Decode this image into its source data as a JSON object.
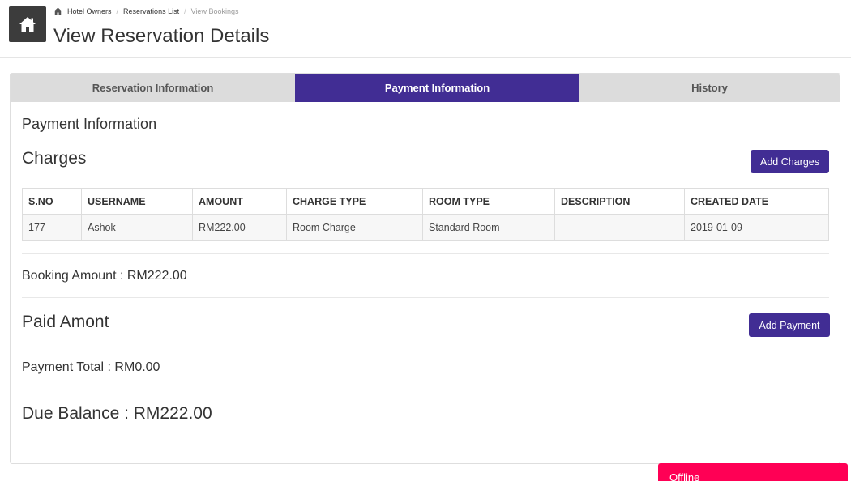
{
  "breadcrumb": {
    "items": [
      "Hotel Owners",
      "Reservations List"
    ],
    "current": "View Bookings"
  },
  "page": {
    "title": "View Reservation Details"
  },
  "tabs": [
    {
      "label": "Reservation Information",
      "active": false
    },
    {
      "label": "Payment Information",
      "active": true
    },
    {
      "label": "History",
      "active": false
    }
  ],
  "payment": {
    "section_title": "Payment Information",
    "charges_title": "Charges",
    "add_charges_label": "Add Charges",
    "table": {
      "headers": [
        "S.NO",
        "USERNAME",
        "AMOUNT",
        "CHARGE TYPE",
        "ROOM TYPE",
        "DESCRIPTION",
        "CREATED DATE"
      ],
      "rows": [
        [
          "177",
          "Ashok",
          "RM222.00",
          "Room Charge",
          "Standard Room",
          "-",
          "2019-01-09"
        ]
      ]
    },
    "booking_amount": "Booking Amount : RM222.00",
    "paid_title": "Paid Amont",
    "add_payment_label": "Add Payment",
    "payment_total": "Payment Total : RM0.00",
    "due_balance": "Due Balance : RM222.00"
  },
  "chat": {
    "status": "Offline"
  },
  "colors": {
    "accent": "#412d94",
    "chat": "#ff0055",
    "tab_bg": "#dcdcdc"
  },
  "icons": {
    "header": "home-icon",
    "breadcrumb": "home-icon"
  }
}
